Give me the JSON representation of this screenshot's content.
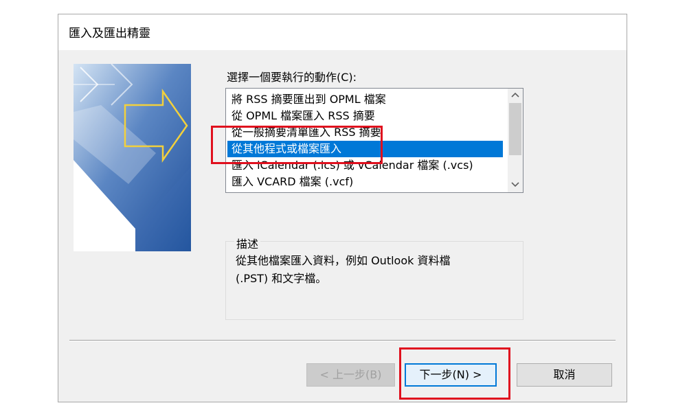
{
  "dialog": {
    "title": "匯入及匯出精靈",
    "prompt": "選擇一個要執行的動作(C):",
    "actions": [
      "將 RSS 摘要匯出到 OPML 檔案",
      "從 OPML 檔案匯入 RSS 摘要",
      "從一般摘要清單匯入 RSS 摘要",
      "從其他程式或檔案匯入",
      "匯入 iCalendar (.ics) 或 vCalendar 檔案 (.vcs)",
      "匯入 VCARD 檔案 (.vcf)"
    ],
    "selected_action": "從其他程式或檔案匯入",
    "description_label": "描述",
    "description_lines": [
      "從其他檔案匯入資料，例如 Outlook 資料檔",
      "(.PST) 和文字檔。"
    ],
    "buttons": {
      "back": "< 上一步(B)",
      "next": "下一步(N) >",
      "cancel": "取消"
    },
    "scroll_icons": {
      "up": "chevron-up-icon",
      "down": "chevron-down-icon"
    }
  },
  "colors": {
    "selection": "#0078d7",
    "highlight": "#e0101e",
    "dialog_bg": "#f0f0f0"
  }
}
